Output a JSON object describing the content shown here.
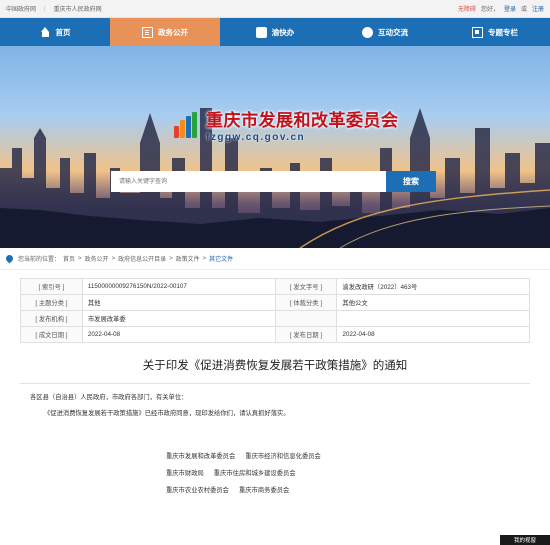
{
  "topbar": {
    "portal1": "中国政府网",
    "portal2": "重庆市人民政府网",
    "accessibility": "无障碍",
    "greeting": "您好，",
    "login": "登录",
    "or": "或",
    "register": "注册"
  },
  "nav": [
    {
      "label": "首页",
      "icon": "home-icon"
    },
    {
      "label": "政务公开",
      "icon": "doc-icon"
    },
    {
      "label": "渝快办",
      "icon": "service-icon"
    },
    {
      "label": "互动交流",
      "icon": "chat-icon"
    },
    {
      "label": "专题专栏",
      "icon": "topic-icon"
    }
  ],
  "banner": {
    "title": "重庆市发展和改革委员会",
    "domain": "fzggw.cq.gov.cn",
    "search_placeholder": "请输入关键字查询",
    "search_button": "搜索"
  },
  "breadcrumb": {
    "prefix": "您当前的位置：",
    "items": [
      "首页",
      "政务公开",
      "政府信息公开目录",
      "政策文件"
    ],
    "current": "其它文件"
  },
  "meta": {
    "index_label": "[ 索引号 ]",
    "index_value": "11500000009276150N/2022-00107",
    "docno_label": "[ 发文字号 ]",
    "docno_value": "渝发改政研〔2022〕463号",
    "topic_label": "[ 主题分类 ]",
    "topic_value": "其他",
    "genre_label": "[ 体裁分类 ]",
    "genre_value": "其他公文",
    "issuer_label": "[ 发布机构 ]",
    "issuer_value": "市发展改革委",
    "created_label": "[ 成文日期 ]",
    "created_value": "2022-04-08",
    "published_label": "[ 发布日期 ]",
    "published_value": "2022-04-08"
  },
  "article": {
    "title": "关于印发《促进消费恢复发展若干政策措施》的通知",
    "salutation": "各区县（自治县）人民政府，市政府各部门，有关单位：",
    "paragraph": "《促进消费恢复发展若干政策措施》已经市政府同意，现印发给你们，请认真抓好落实。",
    "issuers": [
      [
        "重庆市发展和改革委员会",
        "重庆市经济和信息化委员会"
      ],
      [
        "重庆市财政局",
        "重庆市住房和城乡建设委员会"
      ],
      [
        "重庆市农业农村委员会",
        "重庆市商务委员会"
      ]
    ]
  },
  "status_text": "我的视窗",
  "colors": {
    "nav_blue": "#1d6fb5",
    "nav_active": "#e8925a",
    "logo_red": "#c0121a"
  }
}
